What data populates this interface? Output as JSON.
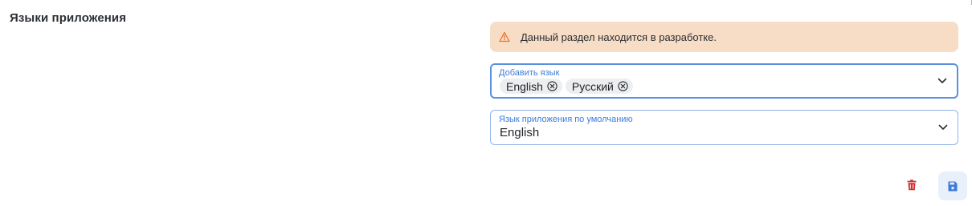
{
  "section": {
    "title": "Языки приложения"
  },
  "alert": {
    "icon": "warning-triangle-icon",
    "text": "Данный раздел находится в разработке.",
    "background_color": "#f7dcc6",
    "icon_color": "#e8742a"
  },
  "languages_field": {
    "label": "Добавить язык",
    "selected": [
      {
        "label": "English"
      },
      {
        "label": "Русский"
      }
    ]
  },
  "default_language_field": {
    "label": "Язык приложения по умолчанию",
    "value": "English"
  },
  "actions": {
    "delete_icon": "trash-icon",
    "save_icon": "floppy-disk-icon",
    "delete_color": "#d32f2f",
    "save_color": "#3d7bd9"
  },
  "accent_color": "#3d7bd9"
}
